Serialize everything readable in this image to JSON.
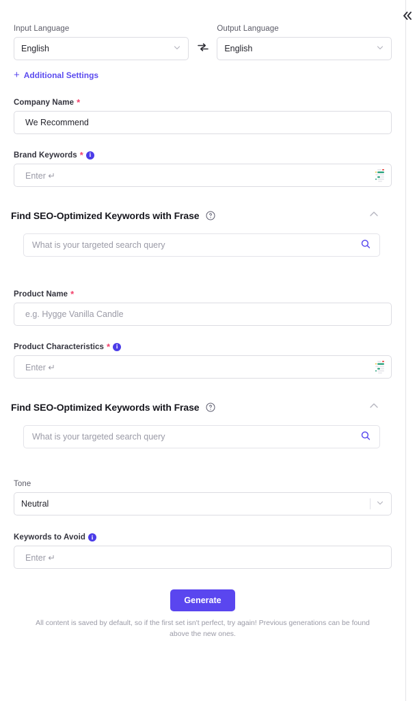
{
  "colors": {
    "accent": "#5b4bef",
    "button": "#5a46ef",
    "required": "#f2416b",
    "info_badge": "#4b3ce8",
    "border": "#dcdce2",
    "placeholder": "#9a9aa6"
  },
  "header": {
    "collapse_icon": "double-chevron-left-icon"
  },
  "language": {
    "input_label": "Input Language",
    "input_value": "English",
    "swap_icon": "swap-arrows-icon",
    "output_label": "Output Language",
    "output_value": "English",
    "chevron_icon": "chevron-down-icon"
  },
  "additional_settings": {
    "plus": "+",
    "label": "Additional Settings"
  },
  "fields": {
    "company_name": {
      "label": "Company Name",
      "required": "*",
      "value": "We Recommend",
      "placeholder": ""
    },
    "brand_keywords": {
      "label": "Brand Keywords",
      "required": "*",
      "info_icon": "info-icon",
      "placeholder": "Enter ↵",
      "tag_icon": "keyword-tags-icon"
    },
    "product_name": {
      "label": "Product Name",
      "required": "*",
      "placeholder": "e.g. Hygge Vanilla Candle"
    },
    "product_characteristics": {
      "label": "Product Characteristics",
      "required": "*",
      "info_icon": "info-icon",
      "placeholder": "Enter ↵",
      "tag_icon": "keyword-tags-icon"
    },
    "tone": {
      "label": "Tone",
      "value": "Neutral",
      "chevron_icon": "chevron-down-icon"
    },
    "keywords_to_avoid": {
      "label": "Keywords to Avoid",
      "info_icon": "info-icon",
      "placeholder": "Enter ↵"
    }
  },
  "seo_sections": [
    {
      "title": "Find SEO-Optimized Keywords with Frase",
      "help_icon": "question-circle-icon",
      "collapse_icon": "chevron-up-icon",
      "search_placeholder": "What is your targeted search query",
      "search_icon": "search-icon"
    },
    {
      "title": "Find SEO-Optimized Keywords with Frase",
      "help_icon": "question-circle-icon",
      "collapse_icon": "chevron-up-icon",
      "search_placeholder": "What is your targeted search query",
      "search_icon": "search-icon"
    }
  ],
  "footer": {
    "generate_label": "Generate",
    "note": "All content is saved by default, so if the first set isn't perfect, try again! Previous generations can be found above the new ones."
  }
}
